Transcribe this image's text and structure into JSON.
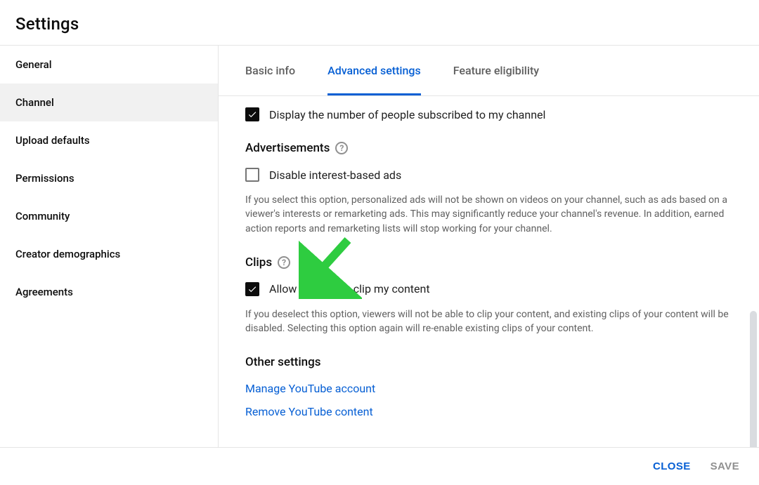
{
  "header": {
    "title": "Settings"
  },
  "sidebar": {
    "items": [
      {
        "label": "General"
      },
      {
        "label": "Channel",
        "active": true
      },
      {
        "label": "Upload defaults"
      },
      {
        "label": "Permissions"
      },
      {
        "label": "Community"
      },
      {
        "label": "Creator demographics"
      },
      {
        "label": "Agreements"
      }
    ]
  },
  "tabs": {
    "basic": "Basic info",
    "advanced": "Advanced settings",
    "feature": "Feature eligibility"
  },
  "subscriber": {
    "label": "Display the number of people subscribed to my channel",
    "checked": true
  },
  "ads": {
    "title": "Advertisements",
    "checkbox_label": "Disable interest-based ads",
    "checked": false,
    "desc": "If you select this option, personalized ads will not be shown on videos on your channel, such as ads based on a viewer's interests or remarketing ads. This may significantly reduce your channel's revenue. In addition, earned action reports and remarketing lists will stop working for your channel."
  },
  "clips": {
    "title": "Clips",
    "checkbox_label": "Allow viewers to clip my content",
    "checked": true,
    "desc": "If you deselect this option, viewers will not be able to clip your content, and existing clips of your content will be disabled. Selecting this option again will re-enable existing clips of your content."
  },
  "other": {
    "title": "Other settings",
    "manage": "Manage YouTube account",
    "remove": "Remove YouTube content"
  },
  "footer": {
    "close": "CLOSE",
    "save": "SAVE"
  }
}
